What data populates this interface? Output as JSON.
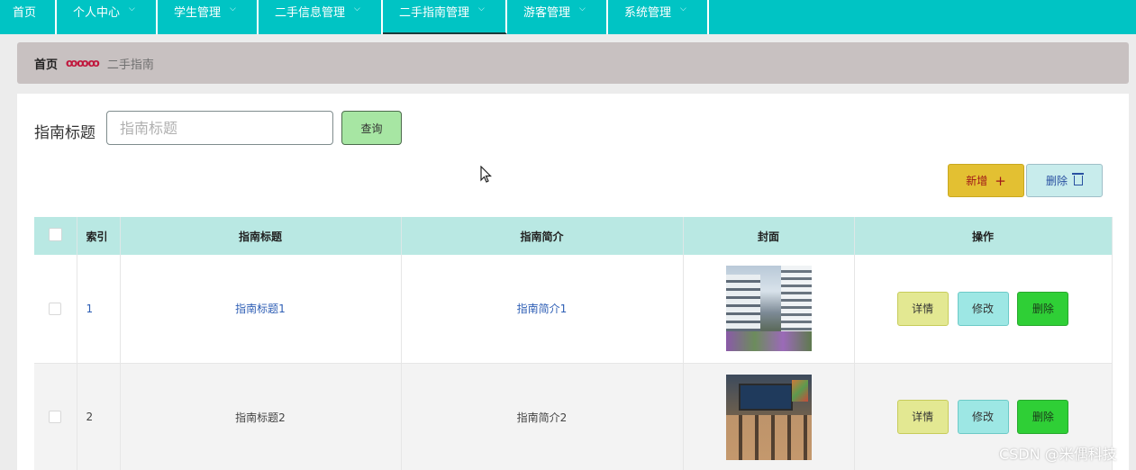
{
  "nav": {
    "items": [
      {
        "label": "首页",
        "has_dropdown": false,
        "active": false
      },
      {
        "label": "个人中心",
        "has_dropdown": true,
        "active": false
      },
      {
        "label": "学生管理",
        "has_dropdown": true,
        "active": false
      },
      {
        "label": "二手信息管理",
        "has_dropdown": true,
        "active": false
      },
      {
        "label": "二手指南管理",
        "has_dropdown": true,
        "active": true
      },
      {
        "label": "游客管理",
        "has_dropdown": true,
        "active": false
      },
      {
        "label": "系统管理",
        "has_dropdown": true,
        "active": false
      }
    ],
    "bg_color": "#00c4c4"
  },
  "breadcrumb": {
    "home": "首页",
    "separator": "ꝏꝏꝏ",
    "current": "二手指南"
  },
  "search": {
    "label": "指南标题",
    "placeholder": "指南标题",
    "value": "",
    "button_label": "查询"
  },
  "actions": {
    "add_label": "新增",
    "delete_label": "删除"
  },
  "table": {
    "headers": {
      "index": "索引",
      "title": "指南标题",
      "summary": "指南简介",
      "cover": "封面",
      "ops": "操作"
    },
    "rows": [
      {
        "index": "1",
        "title": "指南标题1",
        "summary": "指南简介1",
        "cover_icon": "school-building-photo"
      },
      {
        "index": "2",
        "title": "指南标题2",
        "summary": "指南简介2",
        "cover_icon": "classroom-photo"
      }
    ],
    "row_buttons": {
      "detail": "详情",
      "edit": "修改",
      "delete": "删除"
    }
  },
  "watermark": "CSDN @米偶科技"
}
